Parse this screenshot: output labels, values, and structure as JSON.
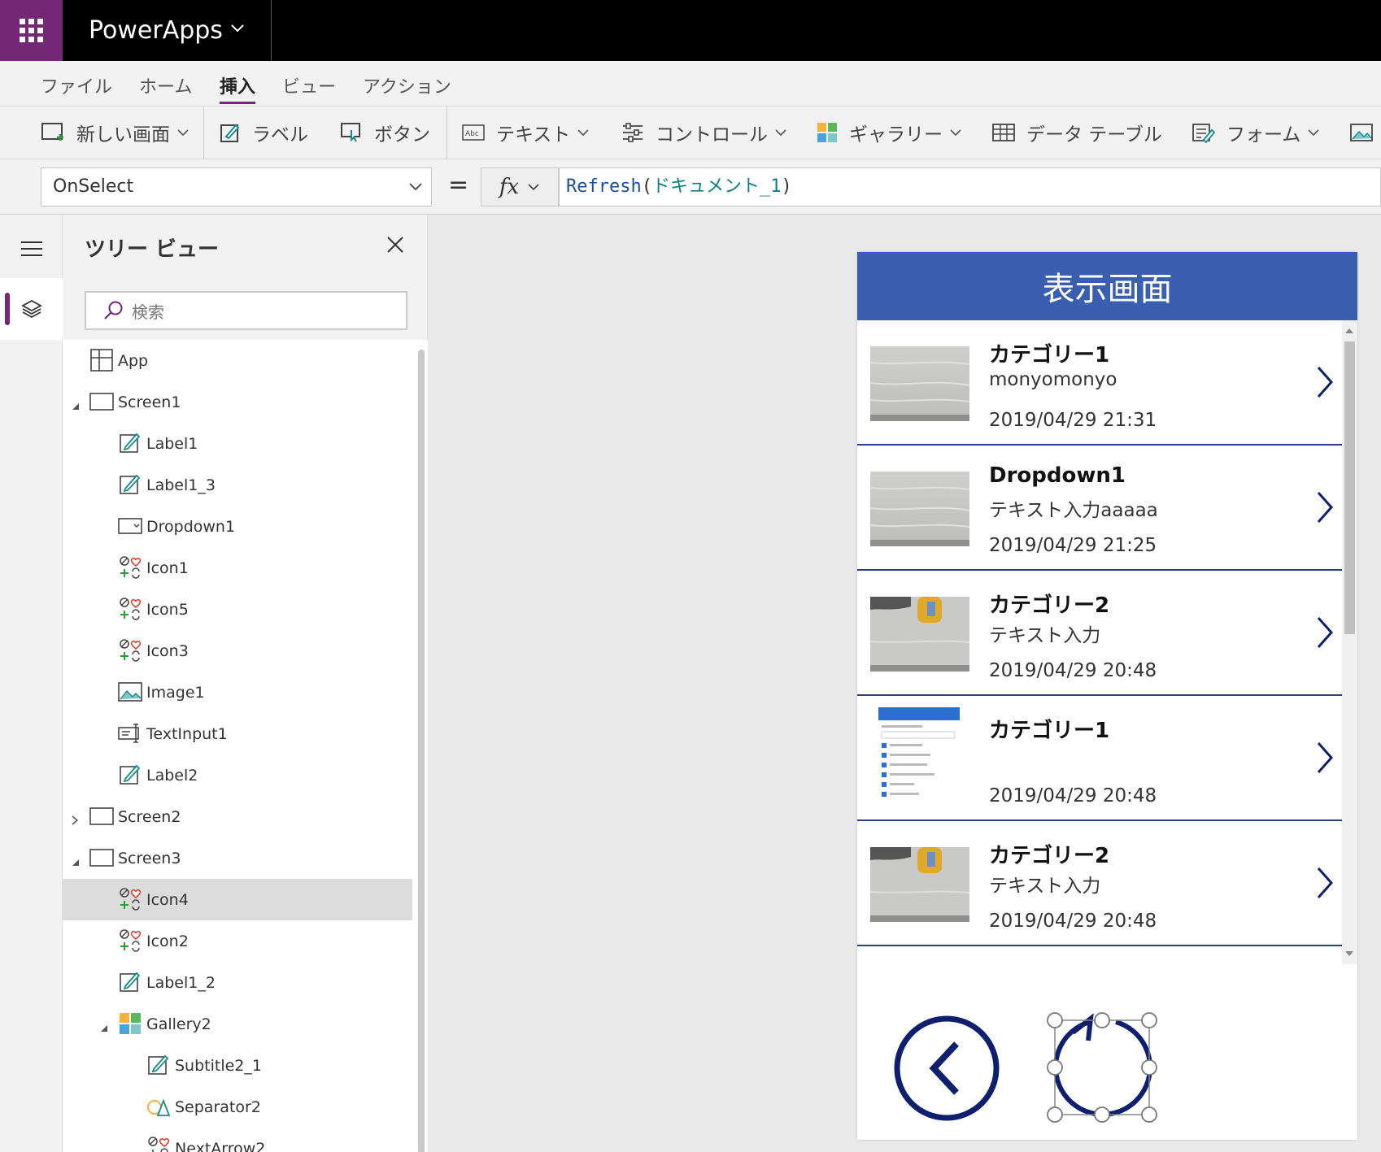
{
  "app": {
    "title": "PowerApps"
  },
  "menu": {
    "items": [
      {
        "label": "ファイル",
        "active": false
      },
      {
        "label": "ホーム",
        "active": false
      },
      {
        "label": "挿入",
        "active": true
      },
      {
        "label": "ビュー",
        "active": false
      },
      {
        "label": "アクション",
        "active": false
      }
    ]
  },
  "ribbon": {
    "new_screen": "新しい画面",
    "label": "ラベル",
    "button": "ボタン",
    "text": "テキスト",
    "controls": "コントロール",
    "gallery": "ギャラリー",
    "data_table": "データ テーブル",
    "form": "フォーム"
  },
  "formula": {
    "property": "OnSelect",
    "equals": "=",
    "fx": "fx",
    "fn": "Refresh",
    "open": "(",
    "arg": "ドキュメント_1",
    "close": ")"
  },
  "tree": {
    "title": "ツリー ビュー",
    "search_placeholder": "検索",
    "items": [
      {
        "label": "App",
        "icon": "app-icon"
      },
      {
        "label": "Screen1",
        "icon": "screen-icon"
      },
      {
        "label": "Label1",
        "icon": "label-icon"
      },
      {
        "label": "Label1_3",
        "icon": "label-icon"
      },
      {
        "label": "Dropdown1",
        "icon": "dropdown-icon"
      },
      {
        "label": "Icon1",
        "icon": "icon-control-icon"
      },
      {
        "label": "Icon5",
        "icon": "icon-control-icon"
      },
      {
        "label": "Icon3",
        "icon": "icon-control-icon"
      },
      {
        "label": "Image1",
        "icon": "image-icon"
      },
      {
        "label": "TextInput1",
        "icon": "text-input-icon"
      },
      {
        "label": "Label2",
        "icon": "label-icon"
      },
      {
        "label": "Screen2",
        "icon": "screen-icon"
      },
      {
        "label": "Screen3",
        "icon": "screen-icon"
      },
      {
        "label": "Icon4",
        "icon": "icon-control-icon",
        "selected": true
      },
      {
        "label": "Icon2",
        "icon": "icon-control-icon"
      },
      {
        "label": "Label1_2",
        "icon": "label-icon"
      },
      {
        "label": "Gallery2",
        "icon": "gallery-icon"
      },
      {
        "label": "Subtitle2_1",
        "icon": "label-icon"
      },
      {
        "label": "Separator2",
        "icon": "shape-icon"
      },
      {
        "label": "NextArrow2",
        "icon": "icon-control-icon"
      }
    ]
  },
  "screen": {
    "header": "表示画面",
    "gallery": [
      {
        "title": "カテゴリー1",
        "subtitle": "monyomonyo",
        "date": "2019/04/29 21:31",
        "thumb": "wood"
      },
      {
        "title": "Dropdown1",
        "subtitle": "テキスト入力aaaaa",
        "date": "2019/04/29 21:25",
        "thumb": "wood"
      },
      {
        "title": "カテゴリー2",
        "subtitle": "テキスト入力",
        "date": "2019/04/29 20:48",
        "thumb": "bottle"
      },
      {
        "title": "カテゴリー1",
        "subtitle": "",
        "date": "2019/04/29 20:48",
        "thumb": "doc"
      },
      {
        "title": "カテゴリー2",
        "subtitle": "テキスト入力",
        "date": "2019/04/29 20:48",
        "thumb": "bottle"
      }
    ]
  },
  "colors": {
    "brand": "#742774",
    "header": "#3b5fb0",
    "icon_navy": "#0e1f6e",
    "separator": "#2b3f88"
  }
}
